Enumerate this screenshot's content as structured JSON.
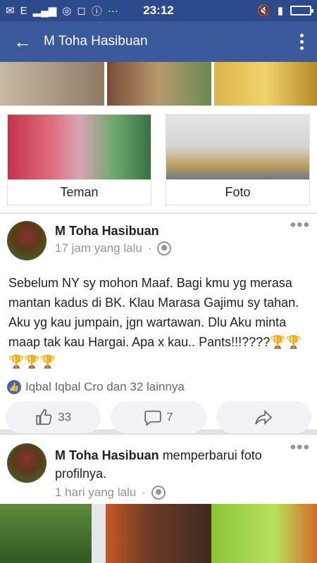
{
  "status_bar": {
    "left_icons": [
      "mail-icon",
      "signal-icon",
      "whatsapp-icon",
      "instagram-icon",
      "alert-icon"
    ],
    "network": "E",
    "dots": "···",
    "time": "23:12",
    "right_icons": [
      "mute-icon",
      "signal-bars-icon",
      "battery-icon"
    ]
  },
  "toolbar": {
    "back_icon": "back-arrow-icon",
    "title": "M Toha Hasibuan",
    "menu_icon": "more-vert-icon"
  },
  "cards": [
    {
      "label": "Teman"
    },
    {
      "label": "Foto"
    }
  ],
  "post1": {
    "author": "M Toha Hasibuan",
    "time": "17 jam yang lalu",
    "visibility_icon": "globe-icon",
    "body": "Sebelum NY sy mohon Maaf. Bagi kmu yg merasa mantan kadus di BK. Klau Marasa Gajimu sy tahan. Aku yg kau jumpain, jgn wartawan. Dlu Aku minta maap tak kau Hargai. Apa x kau.. Pants!!!????🏆🏆🏆🏆🏆",
    "reactions_text": "Iqbal Iqbal Cro dan 32 lainnya",
    "like_count": "33",
    "comment_count": "7"
  },
  "post2": {
    "author": "M Toha Hasibuan",
    "action": " memperbarui foto profilnya.",
    "time": "1 hari yang lalu",
    "visibility_icon": "globe-icon"
  },
  "colors": {
    "status_bar": "#2d4a8a",
    "toolbar": "#3b5998",
    "like_blue": "#4267b2",
    "muted_text": "#90949c"
  }
}
